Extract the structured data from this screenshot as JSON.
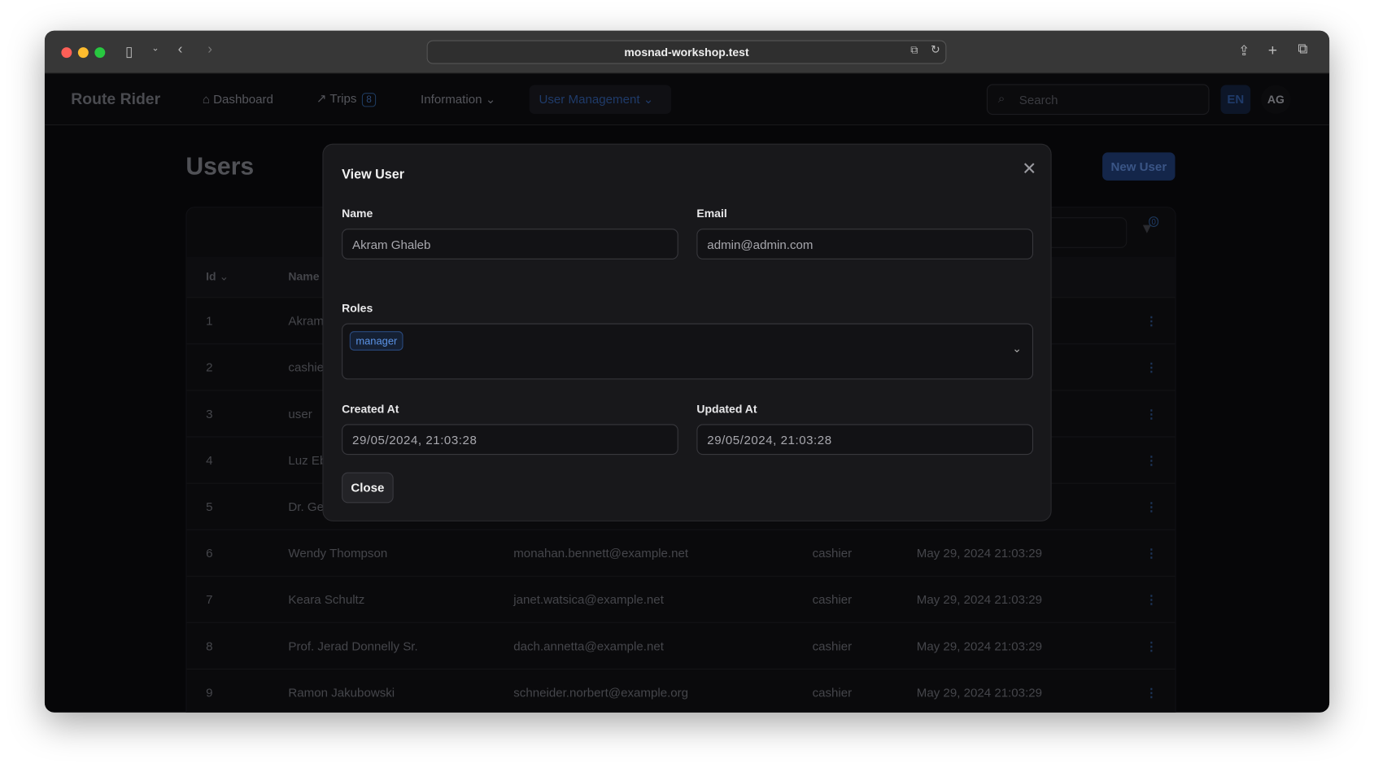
{
  "browser": {
    "url": "mosnad-workshop.test"
  },
  "nav": {
    "brand": "Route Rider",
    "dashboard": "Dashboard",
    "trips": "Trips",
    "trips_count": "8",
    "information": "Information",
    "user_management": "User Management",
    "search_placeholder": "Search",
    "lang": "EN",
    "avatar": "AG"
  },
  "page": {
    "title": "Users",
    "new_user": "New User",
    "filter_count": "0"
  },
  "table": {
    "headers": {
      "id": "Id",
      "name": "Name"
    },
    "rows": [
      {
        "id": "1",
        "name": "Akram",
        "email": "",
        "role": "",
        "created": ""
      },
      {
        "id": "2",
        "name": "cashie",
        "email": "",
        "role": "",
        "created": ""
      },
      {
        "id": "3",
        "name": "user",
        "email": "",
        "role": "",
        "created": ""
      },
      {
        "id": "4",
        "name": "Luz Eb",
        "email": "",
        "role": "",
        "created": ""
      },
      {
        "id": "5",
        "name": "Dr. Ge",
        "email": "",
        "role": "",
        "created": ""
      },
      {
        "id": "6",
        "name": "Wendy Thompson",
        "email": "monahan.bennett@example.net",
        "role": "cashier",
        "created": "May 29, 2024 21:03:29"
      },
      {
        "id": "7",
        "name": "Keara Schultz",
        "email": "janet.watsica@example.net",
        "role": "cashier",
        "created": "May 29, 2024 21:03:29"
      },
      {
        "id": "8",
        "name": "Prof. Jerad Donnelly Sr.",
        "email": "dach.annetta@example.net",
        "role": "cashier",
        "created": "May 29, 2024 21:03:29"
      },
      {
        "id": "9",
        "name": "Ramon Jakubowski",
        "email": "schneider.norbert@example.org",
        "role": "cashier",
        "created": "May 29, 2024 21:03:29"
      }
    ]
  },
  "modal": {
    "title": "View User",
    "name_label": "Name",
    "name_value": "Akram Ghaleb",
    "email_label": "Email",
    "email_value": "admin@admin.com",
    "roles_label": "Roles",
    "roles": [
      "manager"
    ],
    "created_label": "Created At",
    "created_value": "29/05/2024, 21:03:28",
    "updated_label": "Updated At",
    "updated_value": "29/05/2024, 21:03:28",
    "close": "Close"
  },
  "colors": {
    "accent": "#5b93e6",
    "modal_bg": "#18181b",
    "page_bg": "#060608"
  }
}
